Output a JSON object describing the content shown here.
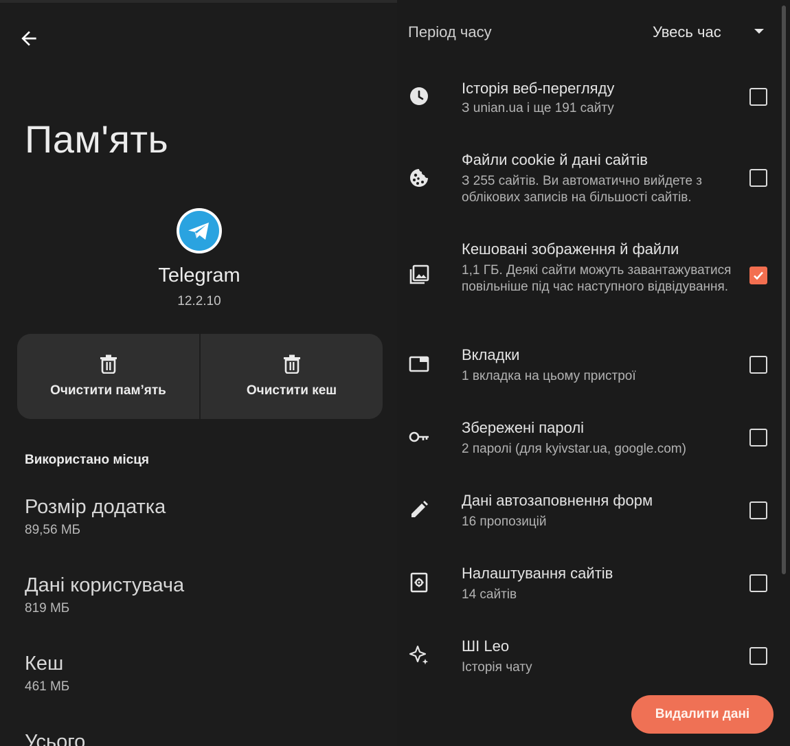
{
  "memory": {
    "title": "Пам'ять",
    "app_name": "Telegram",
    "app_version": "12.2.10",
    "clear_storage_label": "Очистити пам’ять",
    "clear_cache_label": "Очистити кеш",
    "section_label": "Використано місця",
    "stats": [
      {
        "name": "Розмір додатка",
        "value": "89,56 МБ"
      },
      {
        "name": "Дані користувача",
        "value": "819 МБ"
      },
      {
        "name": "Кеш",
        "value": "461 МБ"
      },
      {
        "name": "Усього",
        "value": ""
      }
    ]
  },
  "clear_data": {
    "period_label": "Період часу",
    "period_value": "Увесь час",
    "items": [
      {
        "title": "Історія веб-перегляду",
        "subtitle": "З unian.ua і ще 191 сайту",
        "icon": "history-clock-icon",
        "checked": false
      },
      {
        "title": "Файли cookie й дані сайтів",
        "subtitle": "З 255 сайтів. Ви автоматично вийдете з облікових записів на більшості сайтів.",
        "icon": "cookie-icon",
        "checked": false
      },
      {
        "title": "Кешовані зображення й файли",
        "subtitle": "1,1 ГБ. Деякі сайти можуть завантажуватися повільніше під час наступного відвідування.",
        "icon": "images-icon",
        "checked": true
      },
      {
        "title": "Вкладки",
        "subtitle": "1 вкладка на цьому пристрої",
        "icon": "tab-icon",
        "checked": false
      },
      {
        "title": "Збережені паролі",
        "subtitle": "2 паролі (для kyivstar.ua, google.com)",
        "icon": "key-icon",
        "checked": false
      },
      {
        "title": "Дані автозаповнення форм",
        "subtitle": "16 пропозицій",
        "icon": "pencil-icon",
        "checked": false
      },
      {
        "title": "Налаштування сайтів",
        "subtitle": "14 сайтів",
        "icon": "site-settings-icon",
        "checked": false
      },
      {
        "title": "ШІ Leo",
        "subtitle": "Історія чату",
        "icon": "sparkle-icon",
        "checked": false
      }
    ],
    "delete_label": "Видалити дані"
  },
  "colors": {
    "accent": "#ef7155",
    "telegram_blue": "#2aa3e0",
    "background": "#1b1b1b",
    "button_surface": "#2f2f2f"
  }
}
